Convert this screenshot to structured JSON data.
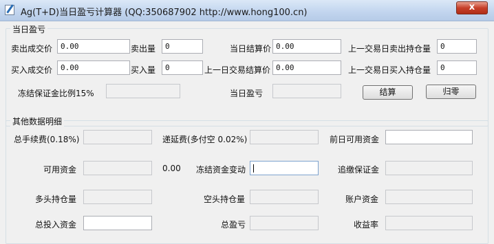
{
  "window": {
    "title": "Ag(T+D)当日盈亏计算器 (QQ:350687902 http://www.hong100.cn)",
    "close_label": "x"
  },
  "daily_pnl": {
    "group_title": "当日盈亏",
    "sell_price_label": "卖出成交价",
    "sell_price_value": "0.00",
    "sell_qty_label": "卖出量",
    "sell_qty_value": "0",
    "settle_price_label": "当日结算价",
    "settle_price_value": "0.00",
    "prev_sell_pos_label": "上一交易日卖出持仓量",
    "prev_sell_pos_value": "0",
    "buy_price_label": "买入成交价",
    "buy_price_value": "0.00",
    "buy_qty_label": "买入量",
    "buy_qty_value": "0",
    "prev_settle_label": "上一日交易结算价",
    "prev_settle_value": "0.00",
    "prev_buy_pos_label": "上一交易日买入持仓量",
    "prev_buy_pos_value": "0",
    "margin_ratio_label": "冻结保证金比例15%",
    "pnl_label": "当日盈亏",
    "calc_button": "结算",
    "reset_button": "归零"
  },
  "other": {
    "group_title": "其他数据明细",
    "total_fee_label": "总手续费(0.18%)",
    "deferral_fee_label": "递延费(多付空 0.02%)",
    "prev_available_label": "前日可用资金",
    "available_label": "可用资金",
    "available_value": "0.00",
    "frozen_change_label": "冻结资金变动",
    "margin_call_label": "追缴保证金",
    "long_pos_label": "多头持仓量",
    "short_pos_label": "空头持仓量",
    "account_funds_label": "账户资金",
    "total_invest_label": "总投入资金",
    "total_pnl_label": "总盈亏",
    "yield_label": "收益率"
  }
}
